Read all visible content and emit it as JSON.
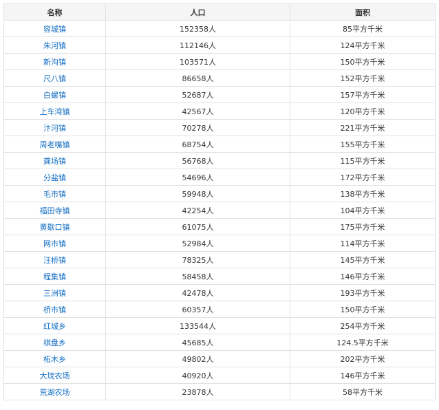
{
  "table": {
    "headers": [
      "名称",
      "人口",
      "面积"
    ],
    "rows": [
      {
        "name": "容城镇",
        "population": "152358人",
        "area": "85平方千米"
      },
      {
        "name": "朱河镇",
        "population": "112146人",
        "area": "124平方千米"
      },
      {
        "name": "新沟镇",
        "population": "103571人",
        "area": "150平方千米"
      },
      {
        "name": "尺八镇",
        "population": "86658人",
        "area": "152平方千米"
      },
      {
        "name": "白螺镇",
        "population": "52687人",
        "area": "157平方千米"
      },
      {
        "name": "上车湾镇",
        "population": "42567人",
        "area": "120平方千米"
      },
      {
        "name": "汴河镇",
        "population": "70278人",
        "area": "221平方千米"
      },
      {
        "name": "周老嘴镇",
        "population": "68754人",
        "area": "155平方千米"
      },
      {
        "name": "龚场镇",
        "population": "56768人",
        "area": "115平方千米"
      },
      {
        "name": "分盐镇",
        "population": "54696人",
        "area": "172平方千米"
      },
      {
        "name": "毛市镇",
        "population": "59948人",
        "area": "138平方千米"
      },
      {
        "name": "福田寺镇",
        "population": "42254人",
        "area": "104平方千米"
      },
      {
        "name": "黄歇口镇",
        "population": "61075人",
        "area": "175平方千米"
      },
      {
        "name": "网市镇",
        "population": "52984人",
        "area": "114平方千米"
      },
      {
        "name": "汪桥镇",
        "population": "78325人",
        "area": "145平方千米"
      },
      {
        "name": "程集镇",
        "population": "58458人",
        "area": "146平方千米"
      },
      {
        "name": "三洲镇",
        "population": "42478人",
        "area": "193平方千米"
      },
      {
        "name": "桥市镇",
        "population": "60357人",
        "area": "150平方千米"
      },
      {
        "name": "红城乡",
        "population": "133544人",
        "area": "254平方千米"
      },
      {
        "name": "棋盘乡",
        "population": "45685人",
        "area": "124.5平方千米"
      },
      {
        "name": "柘木乡",
        "population": "49802人",
        "area": "202平方千米"
      },
      {
        "name": "大垸农场",
        "population": "40920人",
        "area": "146平方千米"
      },
      {
        "name": "荒湖农场",
        "population": "23878人",
        "area": "58平方千米"
      }
    ]
  },
  "colors": {
    "link": "#136ec2",
    "header_bg": "#f5f5f5",
    "border": "#e1e1e1",
    "text": "#333333"
  }
}
